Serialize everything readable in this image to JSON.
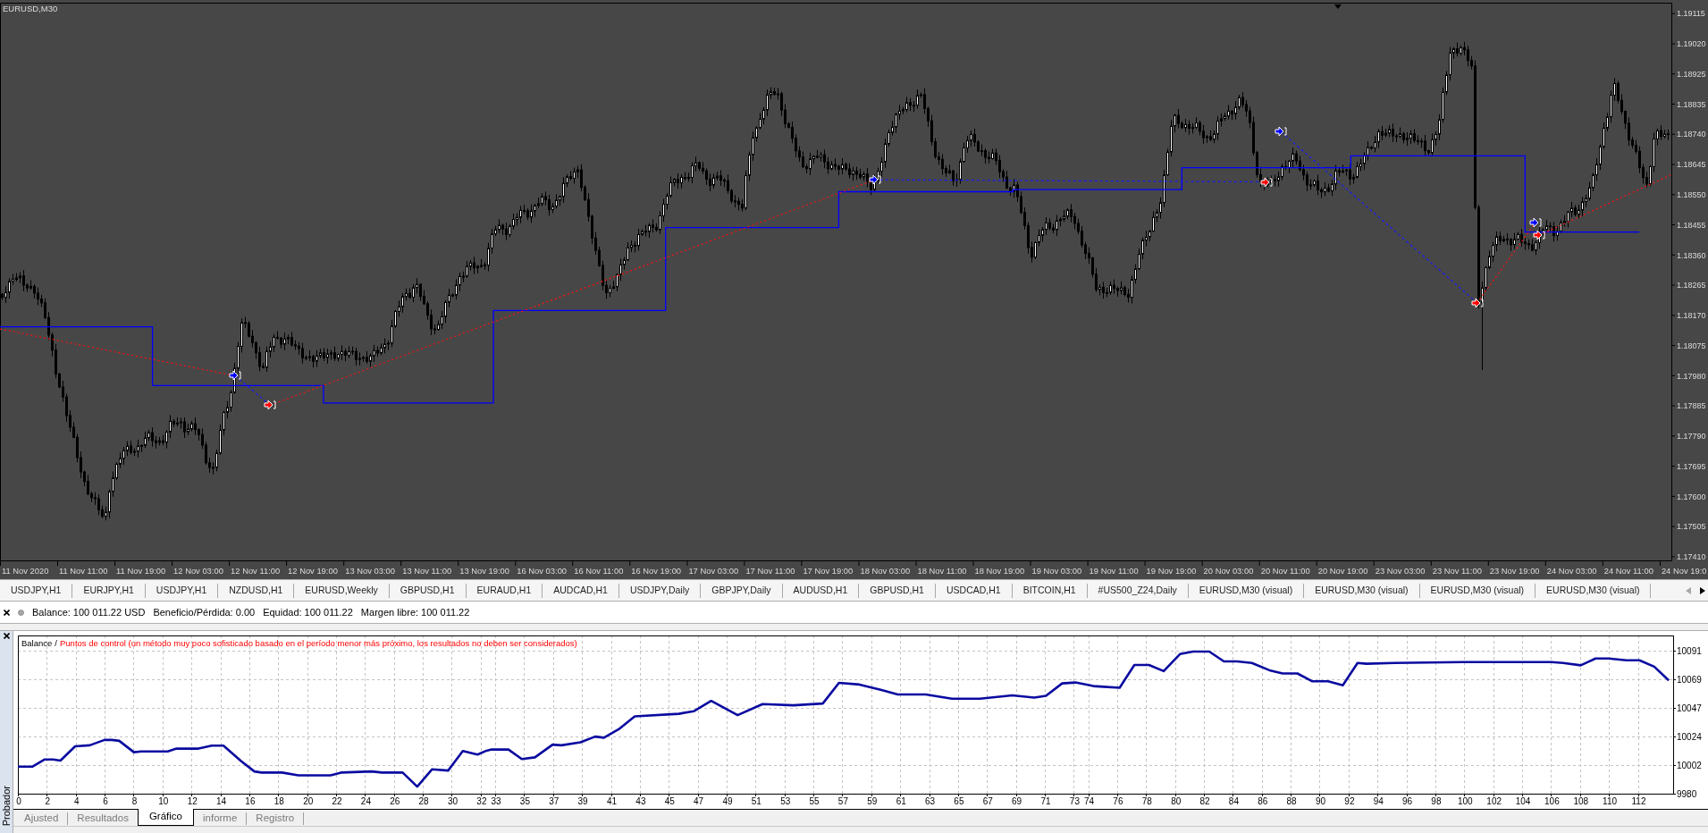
{
  "chart": {
    "title": "EURUSD,M30",
    "price_axis": [
      "1.19115",
      "1.19020",
      "1.18925",
      "1.18835",
      "1.18740",
      "1.18645",
      "1.18550",
      "1.18455",
      "1.18360",
      "1.18265",
      "1.18170",
      "1.18075",
      "1.17980",
      "1.17885",
      "1.17790",
      "1.17695",
      "1.17600",
      "1.17505",
      "1.17410"
    ],
    "time_axis": [
      "11 Nov 2020",
      "11 Nov 11:00",
      "11 Nov 19:00",
      "12 Nov 03:00",
      "12 Nov 11:00",
      "12 Nov 19:00",
      "13 Nov 03:00",
      "13 Nov 11:00",
      "13 Nov 19:00",
      "16 Nov 03:00",
      "16 Nov 11:00",
      "16 Nov 19:00",
      "17 Nov 03:00",
      "17 Nov 11:00",
      "17 Nov 19:00",
      "18 Nov 03:00",
      "18 Nov 11:00",
      "18 Nov 19:00",
      "19 Nov 03:00",
      "19 Nov 11:00",
      "19 Nov 19:00",
      "20 Nov 03:00",
      "20 Nov 11:00",
      "20 Nov 19:00",
      "23 Nov 03:00",
      "23 Nov 11:00",
      "23 Nov 19:00",
      "24 Nov 03:00",
      "24 Nov 11:00",
      "24 Nov 19:0"
    ]
  },
  "chart_tabs": {
    "tabs": [
      {
        "label": "USDJPY,H1",
        "selected": false
      },
      {
        "label": "EURJPY,H1",
        "selected": false
      },
      {
        "label": "USDJPY,H1",
        "selected": false
      },
      {
        "label": "NZDUSD,H1",
        "selected": false
      },
      {
        "label": "EURUSD,Weekly",
        "selected": false
      },
      {
        "label": "GBPUSD,H1",
        "selected": false
      },
      {
        "label": "EURAUD,H1",
        "selected": false
      },
      {
        "label": "AUDCAD,H1",
        "selected": false
      },
      {
        "label": "USDJPY,Daily",
        "selected": false
      },
      {
        "label": "GBPJPY,Daily",
        "selected": false
      },
      {
        "label": "AUDUSD,H1",
        "selected": false
      },
      {
        "label": "GBPUSD,H1",
        "selected": false
      },
      {
        "label": "USDCAD,H1",
        "selected": false
      },
      {
        "label": "BITCOIN,H1",
        "selected": false
      },
      {
        "label": "#US500_Z24,Daily",
        "selected": false
      },
      {
        "label": "EURUSD,M30 (visual)",
        "selected": false
      },
      {
        "label": "EURUSD,M30 (visual)",
        "selected": false
      },
      {
        "label": "EURUSD,M30 (visual)",
        "selected": false
      },
      {
        "label": "EURUSD,M30 (visual)",
        "selected": false
      }
    ],
    "scroll_buttons": [
      {
        "kind": "left",
        "disabled": true
      },
      {
        "kind": "right",
        "disabled": false
      }
    ]
  },
  "terminal": {
    "summary": [
      "Balance: 100 011.22 USD",
      "Beneficio/Pérdida: 0.00",
      "Equidad: 100 011.22",
      "Margen libre: 100 011.22"
    ]
  },
  "tester": {
    "title": "Probador",
    "graph": {
      "separator": "/",
      "note": "Puntos de control (un método muy poco sofisticado basado en el período menor más próximo, los resultados no deben ser considerados)",
      "chart_data": {
        "type": "line",
        "x": [
          0,
          1.02,
          1.83,
          2.44,
          2.94,
          3.96,
          4.97,
          5.99,
          6.5,
          7.01,
          8.02,
          8.53,
          10.36,
          10.96,
          12.49,
          13.4,
          14.21,
          15.43,
          16.35,
          16.85,
          18.27,
          19.39,
          21.62,
          22.34,
          24.47,
          25.18,
          26.6,
          27.61,
          28.63,
          29.75,
          30.76,
          31.78,
          32.4,
          32.75,
          33.92,
          34.84,
          35.75,
          36.97,
          37.58,
          38.9,
          39.91,
          40.52,
          41.54,
          42.65,
          45.7,
          46.72,
          47.93,
          49.76,
          51.49,
          53.62,
          55.65,
          56.77,
          58.19,
          59.71,
          60.83,
          62.76,
          64.58,
          66.51,
          68.75,
          70.27,
          71.08,
          72.2,
          73.11,
          74.35,
          75.06,
          76.17,
          77.19,
          78.2,
          79.22,
          80.34,
          81.25,
          82.37,
          83.38,
          84.29,
          85.31,
          86.53,
          87.44,
          88.46,
          89.47,
          90.59,
          91.6,
          92.62,
          93.23,
          95.16,
          99.93,
          106.02,
          106.83,
          108.05,
          109.07,
          109.98,
          111.2,
          112.11,
          113.13,
          114.14
        ],
        "series": [
          {
            "name": "Balance",
            "color": "#0a0aa0",
            "values": [
              10001,
              10001,
              10006.5,
              10006.5,
              10005.7,
              10016.8,
              10017.5,
              10021.7,
              10021.7,
              10021,
              10012.2,
              10012.8,
              10012.8,
              10015,
              10015,
              10017.3,
              10017.3,
              10005.3,
              9997.3,
              9996.4,
              9996.4,
              9994.2,
              9994.2,
              9996.4,
              9997.3,
              9996.4,
              9996.4,
              9985.5,
              9998.9,
              9998,
              10013.1,
              10010.3,
              10013.4,
              10014.3,
              10014.3,
              10006.9,
              10008.2,
              10018.1,
              10017.5,
              10019.9,
              10024.3,
              10023.4,
              10030,
              10040,
              10042,
              10044,
              10052,
              10041,
              10049.5,
              10048.6,
              10050,
              10066,
              10064.7,
              10060.5,
              10057,
              10057,
              10053.7,
              10053.7,
              10056.3,
              10054.6,
              10056,
              10065.6,
              10066.3,
              10063.5,
              10063,
              10062.2,
              10079.9,
              10079.9,
              10075.1,
              10088.4,
              10090.3,
              10090.3,
              10082.7,
              10082.7,
              10081.5,
              10075.8,
              10073.3,
              10073.3,
              10067.3,
              10067.3,
              10064.1,
              10081.5,
              10080.9,
              10081.5,
              10082.2,
              10082.2,
              10081.5,
              10079.6,
              10084.9,
              10084.9,
              10083.6,
              10083.6,
              10078.6,
              10067.9
            ]
          }
        ],
        "xlim": [
          0,
          114.44
        ],
        "ylim": [
          9980,
          10102.8
        ],
        "xticks": [
          0,
          2,
          4,
          6,
          8,
          10,
          12,
          14,
          16,
          18,
          20,
          22,
          24,
          26,
          28,
          30,
          32,
          33,
          35,
          37,
          39,
          41,
          43,
          45,
          47,
          49,
          51,
          53,
          55,
          57,
          59,
          61,
          63,
          65,
          67,
          69,
          71,
          73,
          74,
          76,
          78,
          80,
          82,
          84,
          86,
          88,
          90,
          92,
          94,
          96,
          98,
          100,
          102,
          104,
          106,
          108,
          110,
          112
        ],
        "yticks": [
          {
            "value": 9980,
            "label": "9980"
          },
          {
            "value": 10002.2,
            "label": "10002"
          },
          {
            "value": 10024.4,
            "label": "10024"
          },
          {
            "value": 10046.6,
            "label": "10047"
          },
          {
            "value": 10068.8,
            "label": "10069"
          },
          {
            "value": 10091,
            "label": "10091"
          }
        ],
        "grid": true
      }
    },
    "tabs": [
      {
        "label": "Ajusted",
        "selected": false
      },
      {
        "label": "Resultados",
        "selected": false
      },
      {
        "label": "Gráfico",
        "selected": true
      },
      {
        "label": "informe",
        "selected": false
      },
      {
        "label": "Registro",
        "selected": false
      }
    ]
  }
}
